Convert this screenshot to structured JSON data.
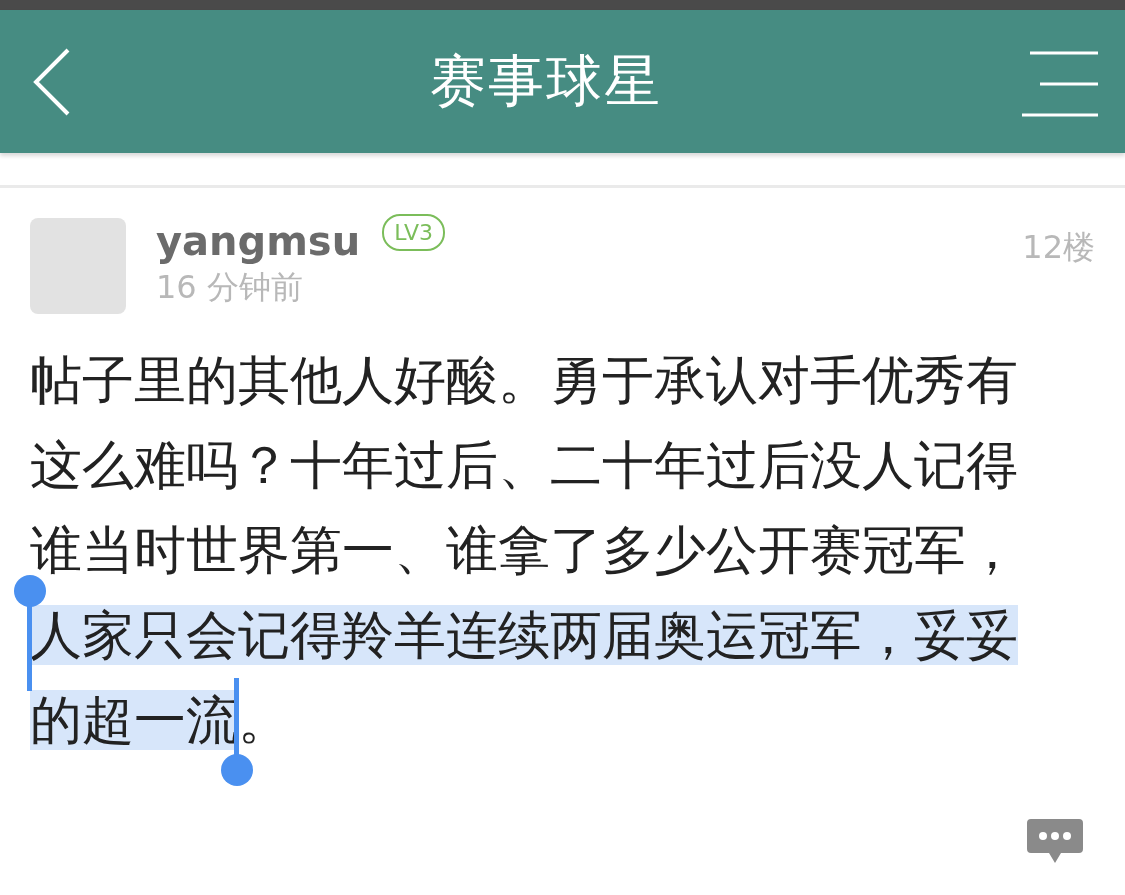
{
  "header": {
    "title": "赛事球星"
  },
  "post": {
    "username": "yangmsu",
    "level_badge": "LV3",
    "time": "16 分钟前",
    "floor": "12楼",
    "body": [
      {
        "text": "帖子里的其他人好酸。勇于承认对手优秀有这么难吗？十年过后、二十年过后没人记得谁当时世界第一、谁拿了多少公开赛冠军，",
        "selected": false
      },
      {
        "text": "人家只会记得羚羊连续两届奥运冠军，妥妥的超一流",
        "selected": true
      },
      {
        "text": "。",
        "selected": false
      }
    ]
  }
}
